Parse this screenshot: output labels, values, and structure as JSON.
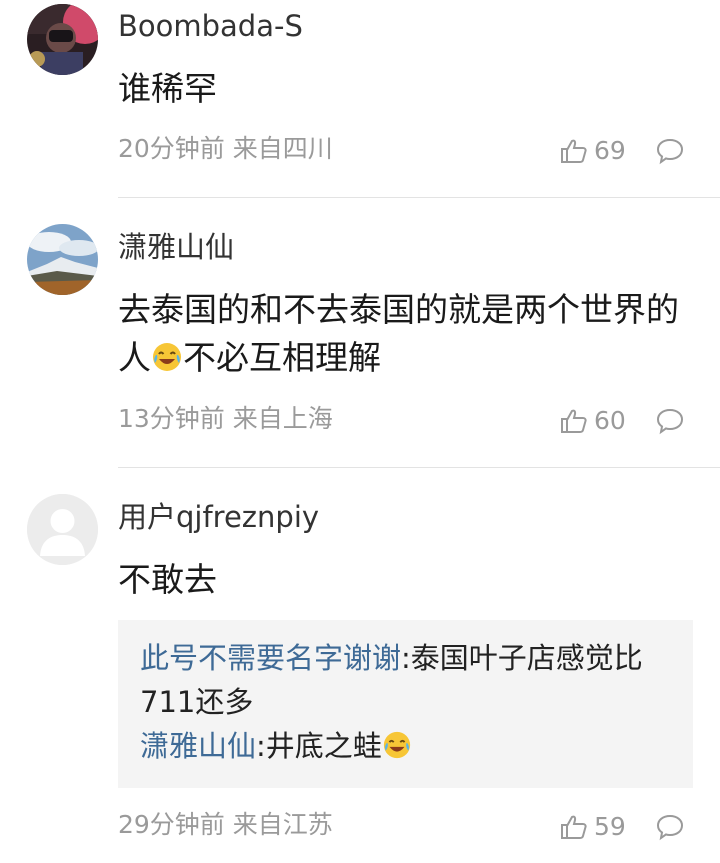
{
  "comments": [
    {
      "username": "Boombada-S",
      "content": "谁稀罕",
      "time": "20分钟前",
      "location": "来自四川",
      "likes": "69"
    },
    {
      "username": "潇雅山仙",
      "content_part1": "去泰国的和不去泰国的就是两个世界的人",
      "content_part2": "不必互相理解",
      "time": "13分钟前",
      "location": "来自上海",
      "likes": "60"
    },
    {
      "username": "用户qjfreznpiy",
      "content": "不敢去",
      "replies": [
        {
          "name": "此号不需要名字谢谢",
          "sep": ":",
          "text": "泰国叶子店感觉比711还多"
        },
        {
          "name": "潇雅山仙",
          "sep": ":",
          "text": "井底之蛙"
        }
      ],
      "time": "29分钟前",
      "location": "来自江苏",
      "likes": "59"
    }
  ],
  "icons": {
    "like": "thumbs-up-icon",
    "reply": "speech-bubble-icon",
    "emoji": "laughing-tears-emoji"
  },
  "colors": {
    "reply_name": "#3e6a96",
    "meta": "#9a9a9a"
  }
}
